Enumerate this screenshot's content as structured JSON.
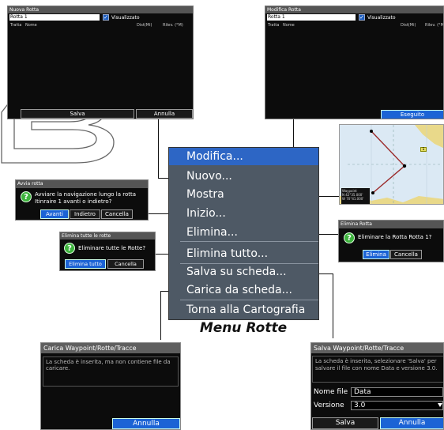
{
  "nuova_rotta": {
    "title": "Nuova Rotta",
    "name_value": "Rotta 1",
    "checkbox_label": "Visualizzato",
    "col_tratta": "Tratta",
    "col_nome": "Nome",
    "col_dist": "Dist(Mi)",
    "col_rilev": "Rilev. (°M)",
    "btn_salva": "Salva",
    "btn_annulla": "Annulla"
  },
  "modifica_rotta": {
    "title": "Modifica Rotta",
    "name_value": "Rotta 1",
    "checkbox_label": "Visualizzato",
    "col_tratta": "Tratta",
    "col_nome": "Nome",
    "col_dist": "Dist(Mi)",
    "col_rilev": "Rilev. (°M",
    "btn_eseguito": "Eseguito"
  },
  "menu": {
    "items": [
      {
        "label": "Modifica..."
      },
      {
        "label": "Nuovo..."
      },
      {
        "label": "Mostra"
      },
      {
        "label": "Inizio..."
      },
      {
        "label": "Elimina..."
      },
      {
        "label": "Elimina tutto..."
      },
      {
        "label": "Salva su scheda..."
      },
      {
        "label": "Carica da scheda..."
      },
      {
        "label": "Torna alla Cartografia"
      }
    ],
    "caption": "Menu Rotte"
  },
  "avvia_rotta": {
    "title": "Avvia rotta",
    "message_line1": "Avviare la navigazione lungo la rotta",
    "message_line2": "Itinraire 1 avanti o indietro?",
    "btn_avanti": "Avanti",
    "btn_indietro": "Indietro",
    "btn_cancella": "Cancella"
  },
  "elimina_tutte": {
    "title": "Elimina tutte le rotte",
    "message": "Eliminare tutte le Rotte?",
    "btn_elimina_tutto": "Elimina tutto",
    "btn_cancella": "Cancella"
  },
  "elimina_rotta": {
    "title": "Elimina Rotta",
    "message": "Eliminare la Rotta Rotta 1?",
    "btn_elimina": "Elimina",
    "btn_cancella": "Cancella"
  },
  "carica": {
    "title": "Carica Waypoint/Rotte/Tracce",
    "message": "La scheda è inserita, ma non contiene file da caricare.",
    "btn_annulla": "Annulla"
  },
  "salva": {
    "title": "Salva Waypoint/Rotte/Tracce",
    "message": "La scheda è inserita, selezionare 'Salva' per salvare il file con nome Data e versione 3.0.",
    "filename_label": "Nome file",
    "filename_value": "Data",
    "version_label": "Versione",
    "version_value": "3.0",
    "btn_salva": "Salva",
    "btn_annulla": "Annulla"
  },
  "map": {
    "info_line1": "Waypoint",
    "info_line2": "N 42°35.000'",
    "info_line3": "W 70°41.000'",
    "badge": "1"
  },
  "colors": {
    "highlight": "#2d66c5",
    "menu_bg": "#4e5965",
    "dialog_bg": "#0c0c0c",
    "question_icon": "#3db33d",
    "map_water": "#dbe9f4",
    "route_line": "#9b2b2b"
  },
  "icons": [
    "question-icon",
    "checkmark-icon",
    "dropdown-arrow-icon",
    "waypoint-icon"
  ]
}
